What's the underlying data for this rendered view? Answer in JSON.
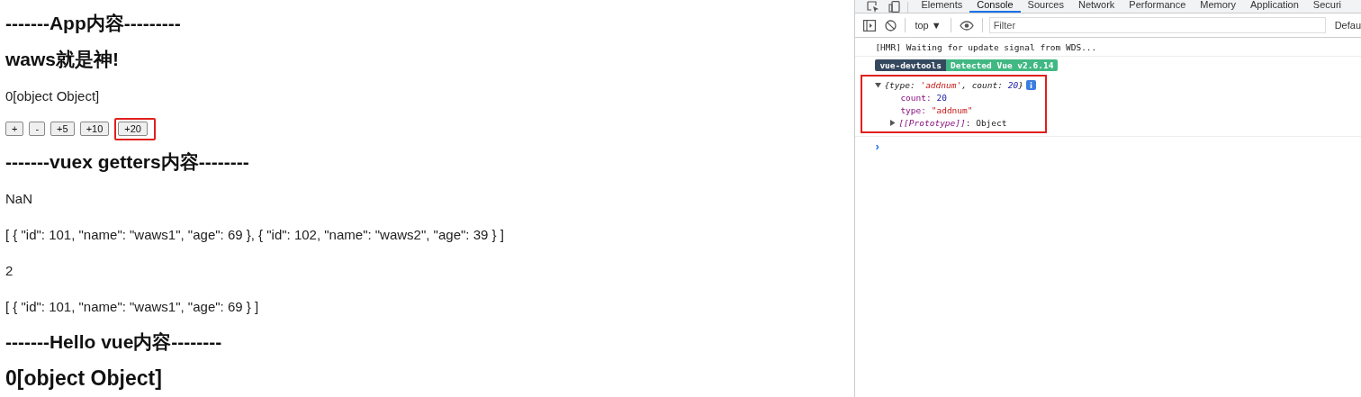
{
  "page": {
    "items": [
      {
        "kind": "heading",
        "text": "-------App内容---------"
      },
      {
        "kind": "heading",
        "text": "waws就是神!"
      },
      {
        "kind": "text",
        "text": "0[object Object]"
      },
      {
        "kind": "buttons",
        "buttons": [
          {
            "label": "+",
            "highlighted": false
          },
          {
            "label": "-",
            "highlighted": false
          },
          {
            "label": "+5",
            "highlighted": false
          },
          {
            "label": "+10",
            "highlighted": false
          },
          {
            "label": "+20",
            "highlighted": true
          }
        ]
      },
      {
        "kind": "heading",
        "text": "-------vuex getters内容--------"
      },
      {
        "kind": "text",
        "text": "NaN"
      },
      {
        "kind": "text",
        "text": "[ { \"id\": 101, \"name\": \"waws1\", \"age\": 69 }, { \"id\": 102, \"name\": \"waws2\", \"age\": 39 } ]"
      },
      {
        "kind": "text",
        "text": "2"
      },
      {
        "kind": "text",
        "text": "[ { \"id\": 101, \"name\": \"waws1\", \"age\": 69 } ]"
      },
      {
        "kind": "heading",
        "text": "-------Hello vue内容--------"
      },
      {
        "kind": "title",
        "text": "0[object Object]"
      }
    ]
  },
  "devtools": {
    "tabs": [
      {
        "label": "Elements",
        "selected": false
      },
      {
        "label": "Console",
        "selected": true
      },
      {
        "label": "Sources",
        "selected": false
      },
      {
        "label": "Network",
        "selected": false
      },
      {
        "label": "Performance",
        "selected": false
      },
      {
        "label": "Memory",
        "selected": false
      },
      {
        "label": "Application",
        "selected": false
      },
      {
        "label": "Securi",
        "selected": false
      }
    ],
    "context": "top ▼",
    "filter": {
      "placeholder": "Filter"
    },
    "levels": "Defau",
    "console": {
      "log": "[HMR] Waiting for update signal from WDS...",
      "badges": [
        "vue-devtools",
        "Detected Vue v2.6.14"
      ],
      "object": {
        "highlighted": true,
        "expanded": true,
        "summary_open": "{type: ",
        "summary_type": "'addnum'",
        "summary_mid": ", count: ",
        "summary_count": "20",
        "summary_close": "}",
        "props": [
          {
            "key": "count:",
            "value": "20",
            "kind": "number"
          },
          {
            "key": "type:",
            "value": "\"addnum\"",
            "kind": "string"
          }
        ],
        "proto_key": "[[Prototype]]",
        "proto_value": ": Object"
      },
      "prompt": "›"
    }
  }
}
